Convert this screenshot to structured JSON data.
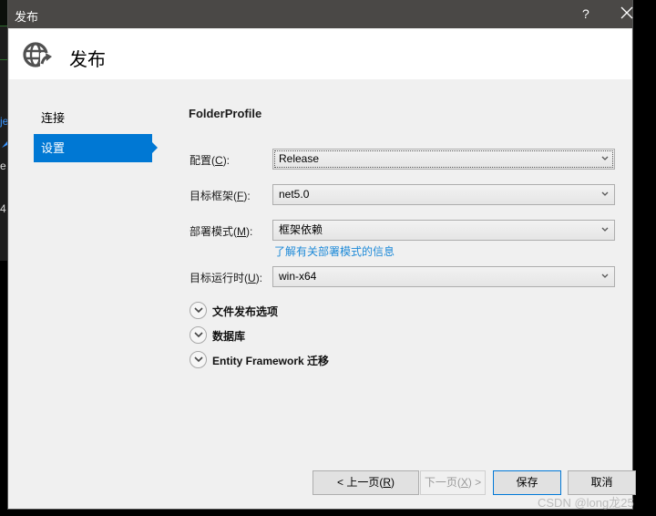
{
  "background_ide": {
    "fragments": [
      {
        "text": "je",
        "color": "blue"
      },
      {
        "text": "",
        "icon": "pencil-icon"
      },
      {
        "text": "e",
        "color": "plain"
      },
      {
        "text": "4",
        "color": "plain"
      }
    ]
  },
  "window": {
    "title": "发布",
    "help_label": "?",
    "close_icon": "close-icon"
  },
  "header": {
    "icon": "globe-publish-icon",
    "title": "发布"
  },
  "sidebar": {
    "items": [
      {
        "label": "连接",
        "active": false
      },
      {
        "label": "设置",
        "active": true
      }
    ]
  },
  "main": {
    "profile_name": "FolderProfile",
    "fields": [
      {
        "label": "配置",
        "mnemonic": "C",
        "value": "Release",
        "focused": true
      },
      {
        "label": "目标框架",
        "mnemonic": "F",
        "value": "net5.0",
        "focused": false
      },
      {
        "label": "部署模式",
        "mnemonic": "M",
        "value": "框架依赖",
        "focused": false
      },
      {
        "label": "目标运行时",
        "mnemonic": "U",
        "value": "win-x64",
        "focused": false
      }
    ],
    "deployment_mode_link": "了解有关部署模式的信息",
    "expanders": [
      {
        "label": "文件发布选项"
      },
      {
        "label": "数据库"
      },
      {
        "label": "Entity Framework 迁移"
      }
    ]
  },
  "footer": {
    "prev_label": "< 上一页(",
    "prev_mnemonic": "R",
    "prev_suffix": ")",
    "next_label": "下一页(",
    "next_mnemonic": "X",
    "next_suffix": ") >",
    "save_label": "保存",
    "cancel_label": "取消"
  },
  "watermark": "CSDN @long龙25"
}
